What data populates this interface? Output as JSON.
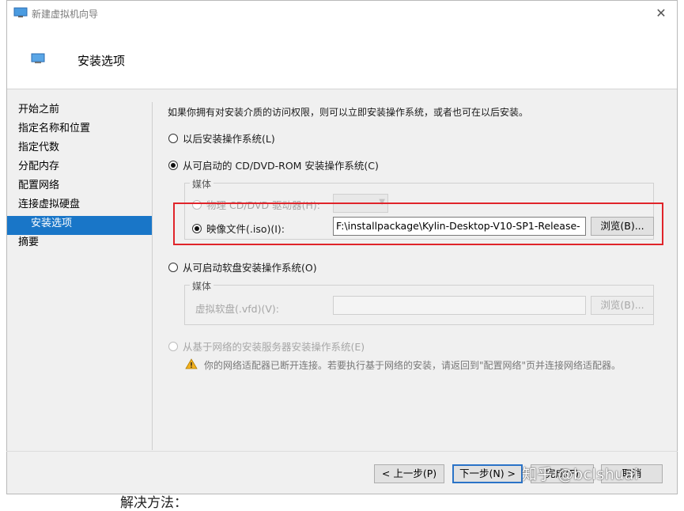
{
  "window": {
    "title": "新建虚拟机向导",
    "close_glyph": "✕"
  },
  "header": {
    "title": "安装选项"
  },
  "nav": {
    "items": [
      {
        "label": "开始之前"
      },
      {
        "label": "指定名称和位置"
      },
      {
        "label": "指定代数"
      },
      {
        "label": "分配内存"
      },
      {
        "label": "配置网络"
      },
      {
        "label": "连接虚拟硬盘"
      },
      {
        "label": "安装选项"
      },
      {
        "label": "摘要"
      }
    ],
    "active_index": 6
  },
  "content": {
    "description": "如果你拥有对安装介质的访问权限，则可以立即安装操作系统，或者也可在以后安装。",
    "option_later": "以后安装操作系统(L)",
    "option_cd": "从可启动的 CD/DVD-ROM 安装操作系统(C)",
    "media_group_label": "媒体",
    "physical_drive_label": "物理 CD/DVD 驱动器(H):",
    "image_file_label": "映像文件(.iso)(I):",
    "image_file_value": "F:\\installpackage\\Kylin-Desktop-V10-SP1-Release-",
    "browse_label": "浏览(B)...",
    "option_floppy": "从可启动软盘安装操作系统(O)",
    "floppy_media_label": "媒体",
    "floppy_label": "虚拟软盘(.vfd)(V):",
    "floppy_value": "",
    "floppy_browse_label": "浏览(B)...",
    "option_network": "从基于网络的安装服务器安装操作系统(E)",
    "warning_text": "你的网络适配器已断开连接。若要执行基于网络的安装，请返回到\"配置网络\"页并连接网络适配器。"
  },
  "footer": {
    "prev_label": "< 上一步(P)",
    "next_label": "下一步(N) >",
    "finish_label": "完成(F)",
    "cancel_label": "取消"
  },
  "overlay": {
    "watermark": "知乎 @bclshuai",
    "below_text": "解决方法："
  },
  "colors": {
    "accent": "#1976c8",
    "highlight": "#e0242a",
    "warning": "#f2b01e"
  }
}
